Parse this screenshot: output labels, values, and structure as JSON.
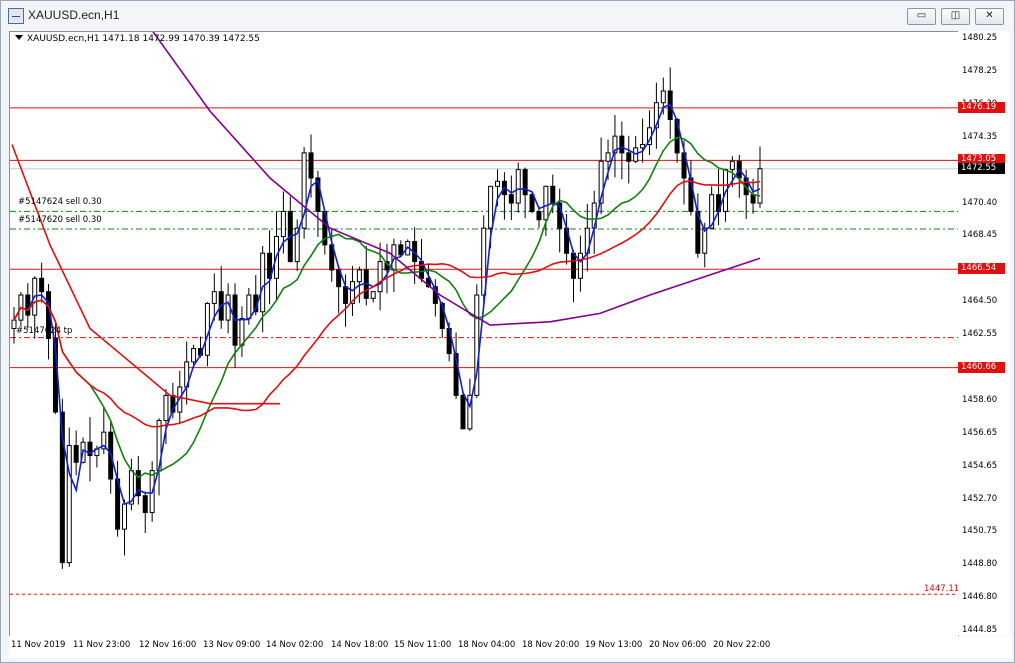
{
  "window": {
    "title": "XAUUSD.ecn,H1",
    "buttons": {
      "minimize": "▭",
      "restore": "◫",
      "close": "✕"
    }
  },
  "chart": {
    "symbol_info": "XAUUSD.ecn,H1  1471.18 1472.99 1470.39 1472.55",
    "orders": [
      {
        "label": "#5147624 sell 0.30",
        "price": 1470.0
      },
      {
        "label": "#5147620 sell 0.30",
        "price": 1468.95
      }
    ],
    "tp_label": "#5147624 tp",
    "tp_price": 1462.45,
    "level_1447": "1447.11",
    "horizontal_lines": [
      1476.19,
      1473.05,
      1466.54,
      1460.66
    ],
    "colors": {
      "red": "#e01010",
      "green_dash": "#0a8a0a",
      "blue_ma": "#1020d0",
      "green_ma": "#108010",
      "red_ma": "#e01010",
      "purple_ma": "#800090"
    }
  },
  "price_axis": {
    "ticks": [
      "1480.25",
      "1478.25",
      "1476.30",
      "1474.35",
      "1472.40",
      "1470.40",
      "1468.45",
      "1466.50",
      "1464.50",
      "1462.55",
      "1460.60",
      "1458.60",
      "1456.65",
      "1454.65",
      "1452.70",
      "1450.75",
      "1448.80",
      "1446.80",
      "1444.85"
    ],
    "tags": [
      {
        "text": "1476.19",
        "style": "red",
        "price": 1476.19
      },
      {
        "text": "1473.05",
        "style": "red",
        "price": 1473.05
      },
      {
        "text": "1472.55",
        "style": "black",
        "price": 1472.55
      },
      {
        "text": "1466.54",
        "style": "red",
        "price": 1466.54
      },
      {
        "text": "1460.66",
        "style": "red",
        "price": 1460.66
      }
    ]
  },
  "time_axis": {
    "labels": [
      "11 Nov 2019",
      "11 Nov 23:00",
      "12 Nov 16:00",
      "13 Nov 09:00",
      "14 Nov 02:00",
      "14 Nov 18:00",
      "15 Nov 11:00",
      "18 Nov 04:00",
      "18 Nov 20:00",
      "19 Nov 13:00",
      "20 Nov 06:00",
      "20 Nov 22:00"
    ]
  },
  "chart_data": {
    "type": "candlestick",
    "title": "XAUUSD.ecn,H1",
    "ylim": [
      1444.85,
      1480.25
    ],
    "last": {
      "open": 1471.18,
      "high": 1472.99,
      "low": 1470.39,
      "close": 1472.55
    },
    "close_path": [
      1463.5,
      1465.0,
      1463.8,
      1466.0,
      1465.2,
      1462.4,
      1458.0,
      1449.0,
      1456.0,
      1455.0,
      1456.2,
      1455.4,
      1455.8,
      1456.8,
      1454.0,
      1451.0,
      1452.5,
      1454.5,
      1453.0,
      1452.0,
      1454.5,
      1457.5,
      1459.0,
      1458.0,
      1459.5,
      1461.0,
      1461.8,
      1461.4,
      1464.5,
      1465.2,
      1463.5,
      1465.0,
      1462.0,
      1463.6,
      1465.0,
      1464.0,
      1467.5,
      1466.0,
      1468.5,
      1470.0,
      1467.0,
      1469.0,
      1473.5,
      1472.0,
      1470.0,
      1468.0,
      1466.5,
      1465.5,
      1464.5,
      1465.8,
      1466.5,
      1464.8,
      1465.2,
      1467.0,
      1466.5,
      1468.0,
      1467.4,
      1468.2,
      1467.0,
      1466.0,
      1465.5,
      1464.5,
      1463.0,
      1461.5,
      1459.0,
      1457.0,
      1459.0,
      1465.0,
      1469.0,
      1471.5,
      1471.8,
      1471.0,
      1470.5,
      1472.5,
      1471.0,
      1470.0,
      1469.5,
      1471.5,
      1470.5,
      1469.0,
      1467.5,
      1466.0,
      1467.5,
      1469.0,
      1470.5,
      1473.0,
      1473.5,
      1474.5,
      1473.5,
      1473.0,
      1473.8,
      1474.0,
      1475.0,
      1476.5,
      1477.2,
      1475.5,
      1473.5,
      1472.0,
      1470.0,
      1467.5,
      1469.0,
      1471.0,
      1470.0,
      1472.5,
      1473.0,
      1472.0,
      1471.0,
      1470.5,
      1472.55
    ],
    "series": [
      {
        "name": "MA fast",
        "color": "blue"
      },
      {
        "name": "MA medium",
        "color": "green"
      },
      {
        "name": "MA slow",
        "color": "red"
      },
      {
        "name": "MA long",
        "color": "purple"
      }
    ]
  }
}
